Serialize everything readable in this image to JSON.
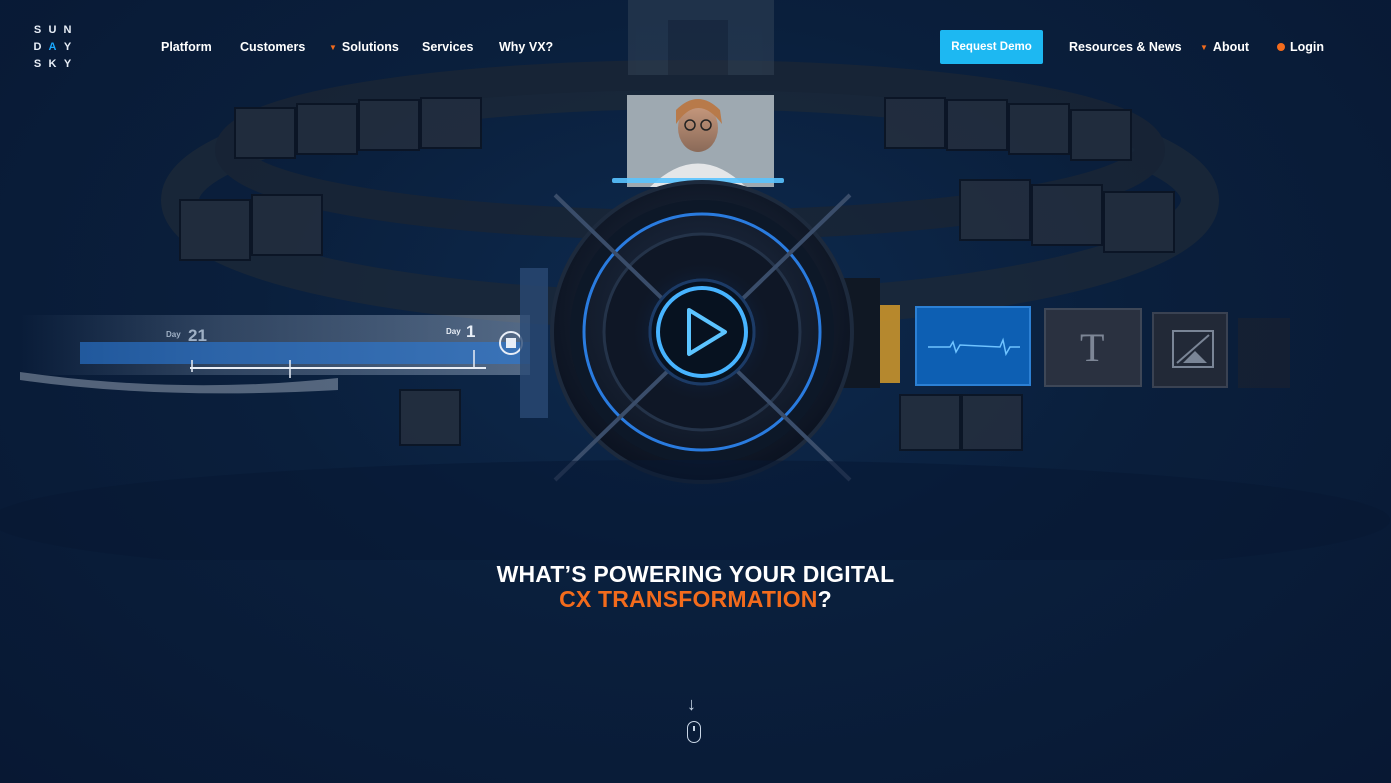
{
  "logo": {
    "letters": [
      "S",
      "U",
      "N",
      "D",
      "A",
      "Y",
      "S",
      "K",
      "Y"
    ],
    "accent_color": "#1aa9ff"
  },
  "nav": {
    "platform": "Platform",
    "customers": "Customers",
    "solutions": "Solutions",
    "services": "Services",
    "why_vx": "Why VX?",
    "request_demo": "Request Demo",
    "resources": "Resources & News",
    "about": "About",
    "login": "Login"
  },
  "hero": {
    "timeline_day_left_label": "Day",
    "timeline_day_left_value": "21",
    "timeline_day_right_label": "Day",
    "timeline_day_right_value": "1",
    "text_tile_glyph": "T",
    "play_icon": "play-icon"
  },
  "headline": {
    "line1": "WHAT’S POWERING YOUR DIGITAL",
    "line2_highlight": "CX TRANSFORMATION",
    "line2_suffix": "?"
  },
  "scroll": {
    "arrow": "↓",
    "icon": "mouse-icon"
  },
  "colors": {
    "background": "#0a1f3c",
    "accent_orange": "#f36b1c",
    "accent_blue": "#1db8f2",
    "glow_blue": "#2f8dff"
  }
}
